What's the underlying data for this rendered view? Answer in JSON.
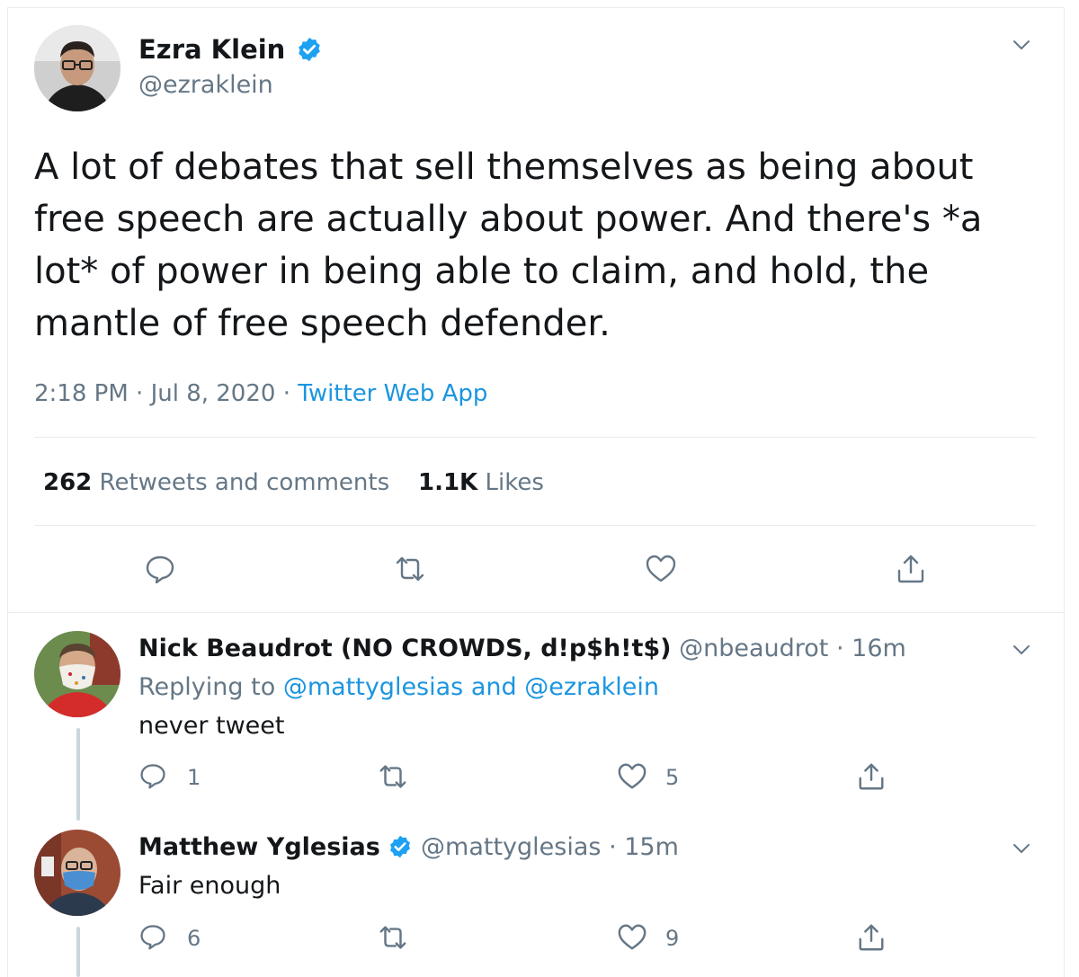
{
  "main_tweet": {
    "author_name": "Ezra Klein",
    "author_handle": "@ezraklein",
    "verified": true,
    "text": "A lot of debates that sell themselves as being about free speech are actually about power. And there's *a lot* of power in being able to claim, and hold, the mantle of free speech defender.",
    "time": "2:18 PM",
    "separator": "·",
    "date": "Jul 8, 2020",
    "source": "Twitter Web App",
    "retweets_count": "262",
    "retweets_label": "Retweets and comments",
    "likes_count": "1.1K",
    "likes_label": "Likes"
  },
  "replies": [
    {
      "author_name": "Nick Beaudrot (NO CROWDS, d!p$h!t$)",
      "author_handle": "@nbeaudrot",
      "separator": "·",
      "age": "16m",
      "replying_prefix": "Replying to",
      "replying_to": "@mattyglesias and @ezraklein",
      "text": "never tweet",
      "reply_count": "1",
      "retweet_count": "",
      "like_count": "5"
    },
    {
      "author_name": "Matthew Yglesias",
      "author_handle": "@mattyglesias",
      "verified": true,
      "separator": "·",
      "age": "15m",
      "text": "Fair enough",
      "reply_count": "6",
      "retweet_count": "",
      "like_count": "9"
    }
  ],
  "icons": {
    "more": "chevron-down-icon",
    "reply": "speech-bubble-icon",
    "retweet": "retweet-arrows-icon",
    "like": "heart-icon",
    "share": "share-upload-icon",
    "verified": "verified-badge-icon"
  },
  "colors": {
    "accent": "#1da1f2",
    "link": "#1b95e0",
    "muted": "#657786",
    "text": "#14171a",
    "border": "#e6ecf0"
  }
}
